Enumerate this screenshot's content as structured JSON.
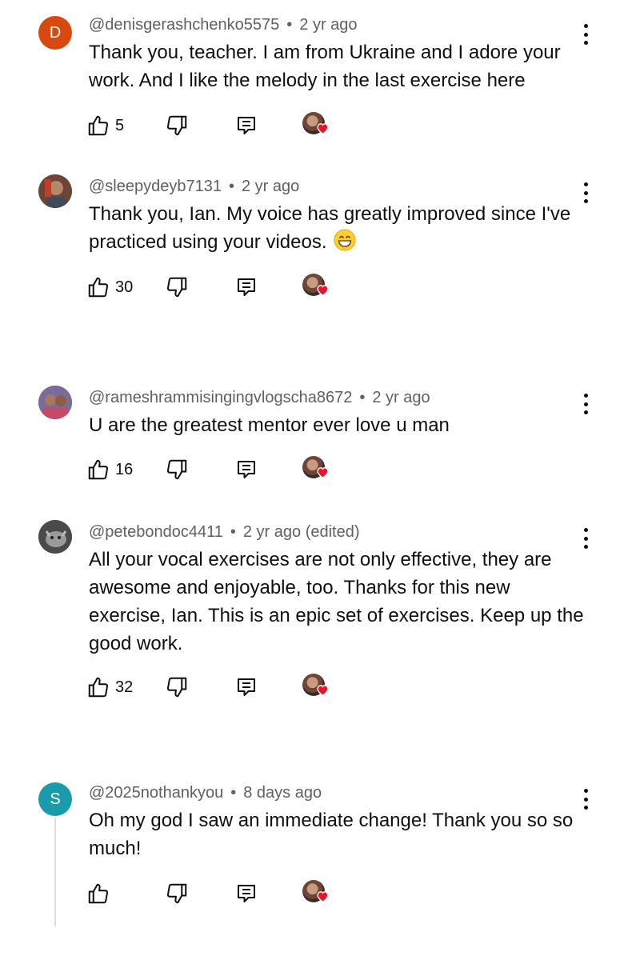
{
  "comments": [
    {
      "avatar_type": "letter",
      "avatar_letter": "D",
      "avatar_color": "#d9480f",
      "author": "@denisgerashchenko5575",
      "separator": "•",
      "time": "2 yr ago",
      "text": "Thank you, teacher. I am from Ukraine and I adore your work. And I like the melody in the last exercise here",
      "likes": "5"
    },
    {
      "avatar_type": "photo",
      "author": "@sleepydeyb7131",
      "separator": "•",
      "time": "2 yr ago",
      "text": "Thank you, Ian. My voice has greatly improved since I've practiced using your videos.",
      "emoji": "grinning-face-emoji",
      "likes": "30"
    },
    {
      "avatar_type": "photo",
      "author": "@rameshrammisingingvlogscha8672",
      "separator": "•",
      "time": "2 yr ago",
      "text": "U are the greatest mentor ever love u man",
      "likes": "16"
    },
    {
      "avatar_type": "photo",
      "author": "@petebondoc4411",
      "separator": "•",
      "time": "2 yr ago (edited)",
      "text": "All your vocal exercises are not only effective, they are awesome and enjoyable, too. Thanks for this new exercise, Ian. This is an epic set of exercises. Keep up the good work.",
      "likes": "32"
    },
    {
      "avatar_type": "letter",
      "avatar_letter": "S",
      "avatar_color": "#1a9bab",
      "author": "@2025nothankyou",
      "separator": "•",
      "time": "8 days ago",
      "text": "Oh my god I saw an immediate change! Thank you so so much!",
      "likes": ""
    }
  ],
  "icons": {
    "like": "thumbs-up-icon",
    "dislike": "thumbs-down-icon",
    "reply": "reply-comment-icon",
    "creator_heart": "creator-heart-badge",
    "more": "more-options-icon"
  },
  "colors": {
    "meta_text": "#606060",
    "body_text": "#0f0f0f",
    "heart": "#e8142d"
  }
}
